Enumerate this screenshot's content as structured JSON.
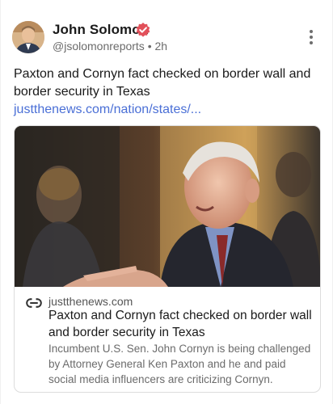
{
  "post": {
    "author_name": "John Solomon",
    "handle": "@jsolomonreports",
    "separator": "•",
    "time": "2h",
    "text": "Paxton and Cornyn fact checked on border wall and border security in Texas ",
    "link_text": "justthenews.com/nation/states/...",
    "verified_color": "#e2505a",
    "link_color": "#4a6fd6"
  },
  "icons": {
    "verified": "verified-badge-icon",
    "more": "more-vertical-icon",
    "link": "link-icon"
  },
  "card": {
    "domain": "justthenews.com",
    "title": "Paxton and Cornyn fact checked on border wall and border security in Texas",
    "description": "Incumbent U.S. Sen. John Cornyn is being challenged by Attorney General Ken Paxton and he and paid social media influencers are criticizing Cornyn."
  }
}
